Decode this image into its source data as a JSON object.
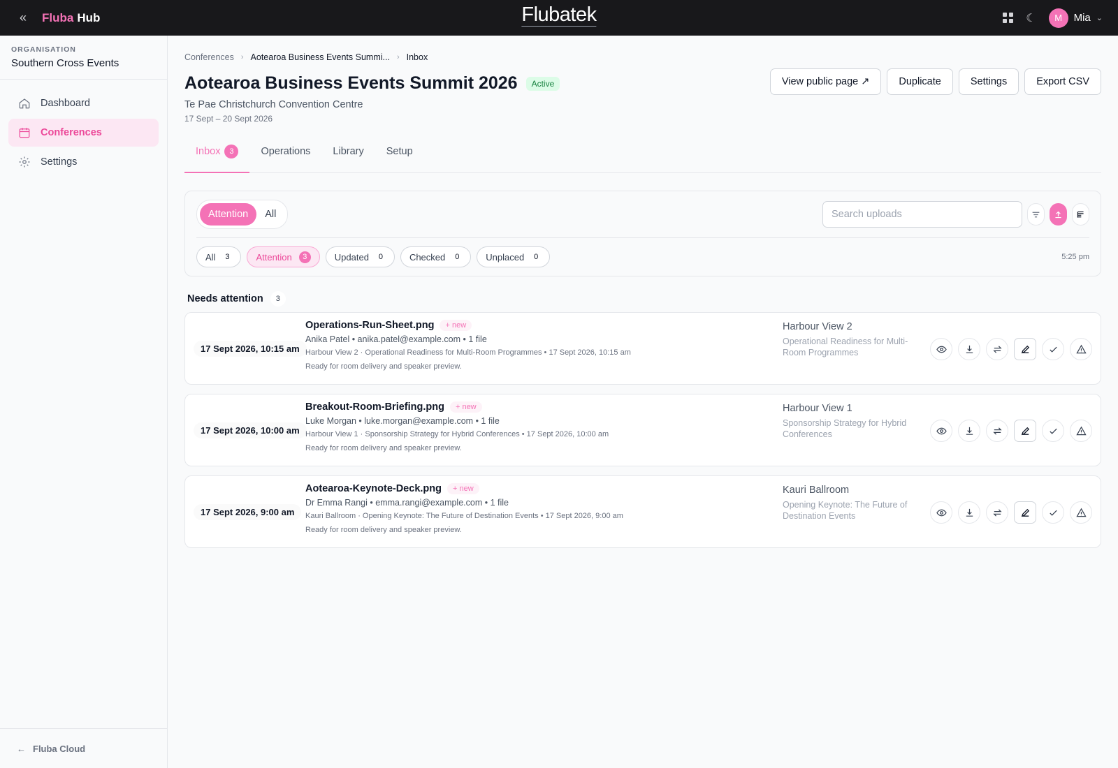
{
  "topbar": {
    "brand_part1": "Fluba",
    "brand_part2": "Hub",
    "center_logo": "Flubatek",
    "user_initial": "M",
    "user_name": "Mia"
  },
  "sidebar": {
    "org_label": "ORGANISATION",
    "org_name": "Southern Cross Events",
    "items": [
      {
        "label": "Dashboard",
        "icon": "home-icon"
      },
      {
        "label": "Conferences",
        "icon": "calendar-icon",
        "active": true
      },
      {
        "label": "Settings",
        "icon": "gear-icon"
      }
    ],
    "footer": "Fluba Cloud"
  },
  "breadcrumb": [
    "Conferences",
    "Aotearoa Business Events Summi...",
    "Inbox"
  ],
  "conference": {
    "title": "Aotearoa Business Events Summit 2026",
    "status": "Active",
    "venue": "Te Pae Christchurch Convention Centre",
    "dates": "17 Sept – 20 Sept 2026"
  },
  "actions": {
    "view_public": "View public page ↗",
    "duplicate": "Duplicate",
    "settings": "Settings",
    "export": "Export CSV"
  },
  "tabs": [
    {
      "label": "Inbox",
      "count": "3",
      "active": true
    },
    {
      "label": "Operations"
    },
    {
      "label": "Library"
    },
    {
      "label": "Setup"
    }
  ],
  "filters": {
    "segment": [
      "Attention",
      "All"
    ],
    "search_placeholder": "Search uploads",
    "chips": [
      {
        "label": "All",
        "count": "3"
      },
      {
        "label": "Attention",
        "count": "3",
        "active": true
      },
      {
        "label": "Updated",
        "count": "0"
      },
      {
        "label": "Checked",
        "count": "0"
      },
      {
        "label": "Unplaced",
        "count": "0"
      }
    ],
    "time": "5:25 pm"
  },
  "section": {
    "title": "Needs attention",
    "count": "3"
  },
  "uploads": [
    {
      "time": "17 Sept 2026, 10:15 am",
      "file": "Operations-Run-Sheet.png",
      "badge": "+ new",
      "uploader": "Anika Patel • anika.patel@example.com • 1 file",
      "context": "Harbour View 2 · Operational Readiness for Multi-Room Programmes • 17 Sept 2026, 10:15 am",
      "note": "Ready for room delivery and speaker preview.",
      "room": "Harbour View 2",
      "session": "Operational Readiness for Multi-Room Programmes"
    },
    {
      "time": "17 Sept 2026, 10:00 am",
      "file": "Breakout-Room-Briefing.png",
      "badge": "+ new",
      "uploader": "Luke Morgan • luke.morgan@example.com • 1 file",
      "context": "Harbour View 1 · Sponsorship Strategy for Hybrid Conferences • 17 Sept 2026, 10:00 am",
      "note": "Ready for room delivery and speaker preview.",
      "room": "Harbour View 1",
      "session": "Sponsorship Strategy for Hybrid Conferences"
    },
    {
      "time": "17 Sept 2026, 9:00 am",
      "file": "Aotearoa-Keynote-Deck.png",
      "badge": "+ new",
      "uploader": "Dr Emma Rangi • emma.rangi@example.com • 1 file",
      "context": "Kauri Ballroom · Opening Keynote: The Future of Destination Events • 17 Sept 2026, 9:00 am",
      "note": "Ready for room delivery and speaker preview.",
      "room": "Kauri Ballroom",
      "session": "Opening Keynote: The Future of Destination Events"
    }
  ],
  "colors": {
    "accent": "#f472b6",
    "topbar": "#18181b",
    "active_bg": "#fce7f3",
    "status_green": "#15803d"
  }
}
